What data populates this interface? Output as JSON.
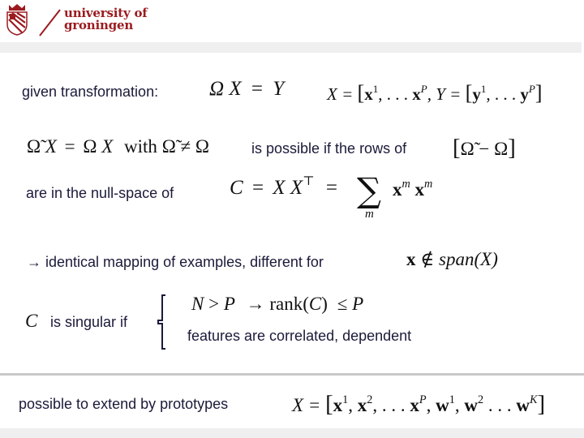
{
  "header": {
    "logo_line1": "university of",
    "logo_line2": "groningen",
    "brand_color": "#9b1b1f",
    "logo_icon": "university-shield-crest"
  },
  "rows": {
    "given": {
      "label": "given transformation:",
      "eq_lhs": "Ω X",
      "eq_eq": "=",
      "eq_rhs": "Y",
      "def_X": "X = ",
      "def_X_vec": "x",
      "def_X_sup1": "1",
      "def_X_dots": ", . . . ",
      "def_X_supP": "P",
      "def_Y": ", Y = ",
      "def_Y_vec": "y",
      "def_Y_sup1": "1",
      "def_Y_dots": ", . . . ",
      "def_Y_supP": "P"
    },
    "possible": {
      "eq_omega_tilde": "Ω̃",
      "eq_x1": "X",
      "eq_eq": "=",
      "eq_omega": "Ω",
      "eq_x2": "X",
      "eq_with": "with",
      "eq_neq": "≠",
      "label": "is possible if the rows of",
      "bracket_expr_tilde": "Ω̃",
      "bracket_minus": "−",
      "bracket_omega": "Ω"
    },
    "nullspace": {
      "label": "are in the null-space of",
      "eq_C": "C",
      "eq_eq1": "=",
      "eq_X": "X X",
      "eq_T": "⊤",
      "eq_eq2": "=",
      "sum": "∑",
      "sum_index": "m",
      "term_vec1": "x",
      "term_sup1": "m",
      "term_vec2": "x",
      "term_sup2": "m"
    },
    "mapping": {
      "label": "→ identical mapping of examples, different for",
      "eq_x": "x",
      "eq_notin": "∉",
      "eq_span": "span(X)"
    },
    "singular": {
      "eq_C": "C",
      "label": "is singular if",
      "cond1_N": "N",
      "cond1_gt": ">",
      "cond1_P": "P",
      "cond1_arrow": "→",
      "cond1_rank": "rank(",
      "cond1_C": "C",
      "cond1_close": ")",
      "cond1_le": "≤",
      "cond1_P2": "P",
      "cond2": "features are correlated, dependent"
    },
    "prototypes": {
      "label": "possible to extend by prototypes",
      "eq": "X = ",
      "x": "x",
      "s1": "1",
      "s2": "2",
      "sP": "P",
      "w": "w",
      "sK": "K"
    }
  }
}
